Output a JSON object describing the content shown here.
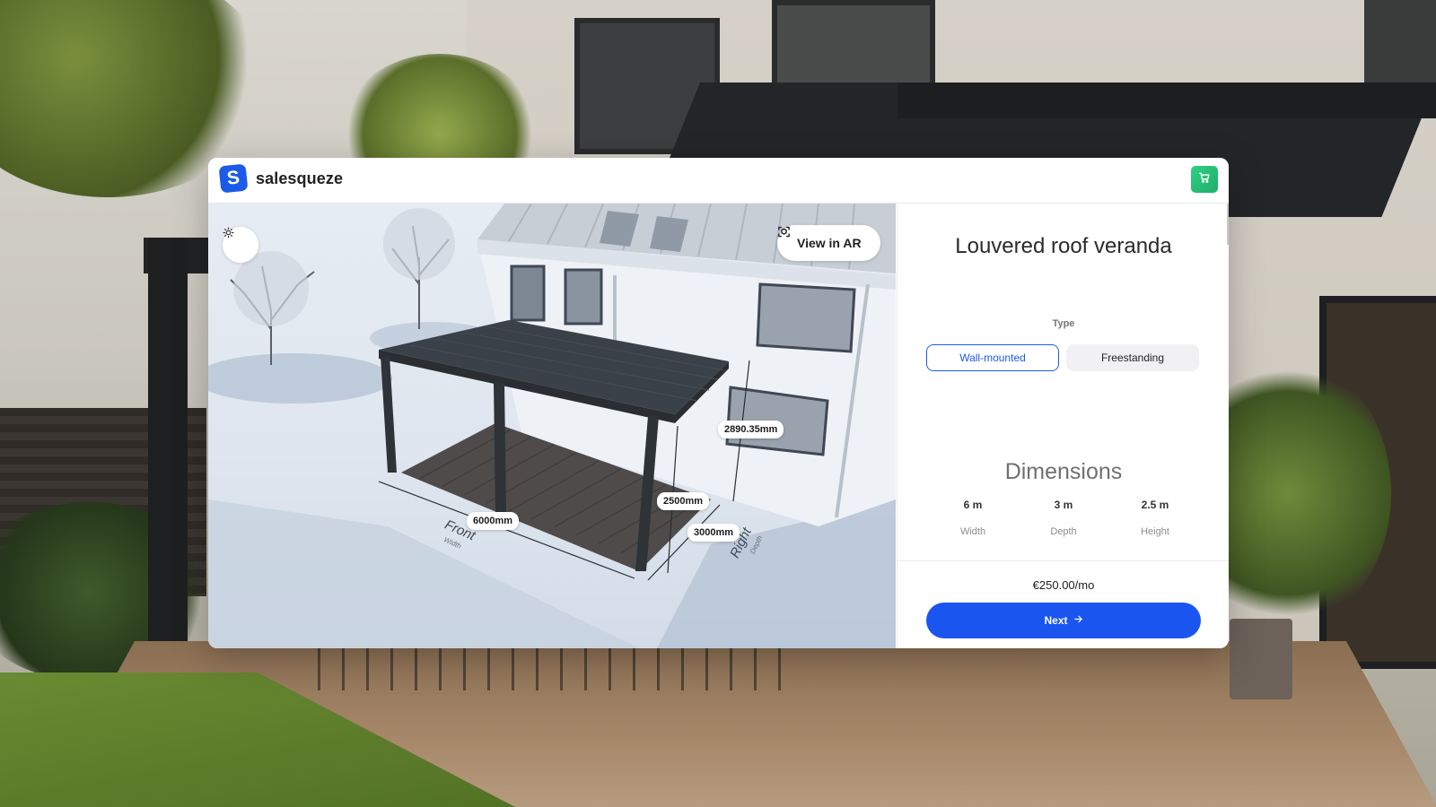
{
  "brand": {
    "name": "salesqueze",
    "logo_letter": "S"
  },
  "header": {
    "cart_icon": "cart-icon"
  },
  "viewer": {
    "ar_button_label": "View in AR",
    "ar_icon": "scan-ar-icon",
    "light_icon": "sun-icon",
    "measurements": {
      "height_total": "2890.35mm",
      "height_post": "2500mm",
      "width": "6000mm",
      "depth": "3000mm"
    },
    "side_labels": {
      "front": "Front",
      "front_sub": "Width",
      "right": "Right",
      "right_sub": "Depth"
    }
  },
  "product": {
    "title": "Louvered roof veranda"
  },
  "type": {
    "label": "Type",
    "options": [
      "Wall-mounted",
      "Freestanding"
    ],
    "selected": "Wall-mounted"
  },
  "dimensions": {
    "title": "Dimensions",
    "items": [
      {
        "value": "6 m",
        "label": "Width"
      },
      {
        "value": "3 m",
        "label": "Depth"
      },
      {
        "value": "2.5 m",
        "label": "Height"
      }
    ]
  },
  "pricing": {
    "price": "€250.00/mo"
  },
  "actions": {
    "next_label": "Next",
    "next_icon": "arrow-right-icon"
  },
  "colors": {
    "accent": "#1b55f0",
    "cart": "#2fd084"
  }
}
